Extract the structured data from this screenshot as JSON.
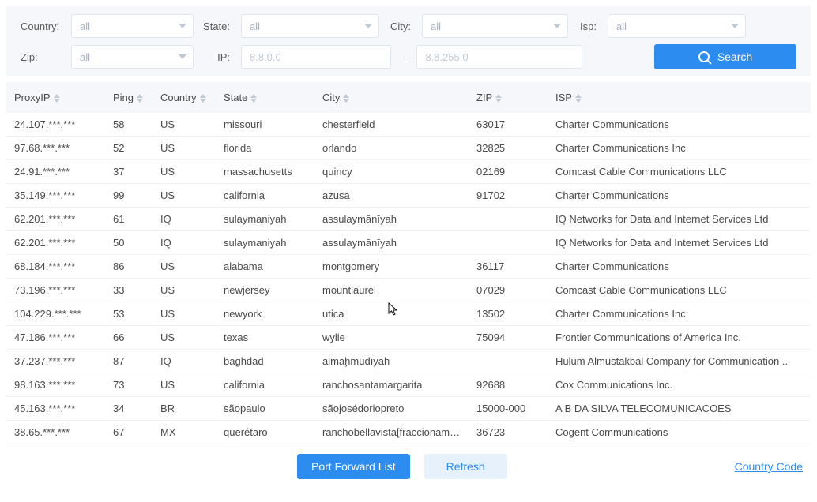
{
  "filters": {
    "country": {
      "label": "Country:",
      "value": "all"
    },
    "state": {
      "label": "State:",
      "value": "all"
    },
    "city": {
      "label": "City:",
      "value": "all"
    },
    "isp": {
      "label": "Isp:",
      "value": "all"
    },
    "zip": {
      "label": "Zip:",
      "value": "all"
    },
    "ip": {
      "label": "IP:",
      "from_placeholder": "8.8.0.0",
      "to_placeholder": "8.8.255.0",
      "dash": "-"
    }
  },
  "search_button": "Search",
  "columns": {
    "proxyip": "ProxyIP",
    "ping": "Ping",
    "country": "Country",
    "state": "State",
    "city": "City",
    "zip": "ZIP",
    "isp": "ISP"
  },
  "rows": [
    {
      "proxy": "24.107.***.***",
      "ping": "58",
      "country": "US",
      "state": "missouri",
      "city": "chesterfield",
      "zip": "63017",
      "isp": "Charter Communications"
    },
    {
      "proxy": "97.68.***.***",
      "ping": "52",
      "country": "US",
      "state": "florida",
      "city": "orlando",
      "zip": "32825",
      "isp": "Charter Communications Inc"
    },
    {
      "proxy": "24.91.***.***",
      "ping": "37",
      "country": "US",
      "state": "massachusetts",
      "city": "quincy",
      "zip": "02169",
      "isp": "Comcast Cable Communications LLC"
    },
    {
      "proxy": "35.149.***.***",
      "ping": "99",
      "country": "US",
      "state": "california",
      "city": "azusa",
      "zip": "91702",
      "isp": "Charter Communications"
    },
    {
      "proxy": "62.201.***.***",
      "ping": "61",
      "country": "IQ",
      "state": "sulaymaniyah",
      "city": "assulaymānīyah",
      "zip": "",
      "isp": "IQ Networks for Data and Internet Services Ltd"
    },
    {
      "proxy": "62.201.***.***",
      "ping": "50",
      "country": "IQ",
      "state": "sulaymaniyah",
      "city": "assulaymānīyah",
      "zip": "",
      "isp": "IQ Networks for Data and Internet Services Ltd"
    },
    {
      "proxy": "68.184.***.***",
      "ping": "86",
      "country": "US",
      "state": "alabama",
      "city": "montgomery",
      "zip": "36117",
      "isp": "Charter Communications"
    },
    {
      "proxy": "73.196.***.***",
      "ping": "33",
      "country": "US",
      "state": "newjersey",
      "city": "mountlaurel",
      "zip": "07029",
      "isp": "Comcast Cable Communications LLC"
    },
    {
      "proxy": "104.229.***.***",
      "ping": "53",
      "country": "US",
      "state": "newyork",
      "city": "utica",
      "zip": "13502",
      "isp": "Charter Communications Inc"
    },
    {
      "proxy": "47.186.***.***",
      "ping": "66",
      "country": "US",
      "state": "texas",
      "city": "wylie",
      "zip": "75094",
      "isp": "Frontier Communications of America Inc."
    },
    {
      "proxy": "37.237.***.***",
      "ping": "87",
      "country": "IQ",
      "state": "baghdad",
      "city": "almaḩmūdīyah",
      "zip": "",
      "isp": "Hulum Almustakbal Company for Communication .."
    },
    {
      "proxy": "98.163.***.***",
      "ping": "73",
      "country": "US",
      "state": "california",
      "city": "ranchosantamargarita",
      "zip": "92688",
      "isp": "Cox Communications Inc."
    },
    {
      "proxy": "45.163.***.***",
      "ping": "34",
      "country": "BR",
      "state": "sãopaulo",
      "city": "sãojosédoriopreto",
      "zip": "15000-000",
      "isp": "A B DA SILVA TELECOMUNICACOES"
    },
    {
      "proxy": "38.65.***.***",
      "ping": "67",
      "country": "MX",
      "state": "querétaro",
      "city": "ranchobellavista[fraccionamie..",
      "zip": "36723",
      "isp": "Cogent Communications"
    }
  ],
  "buttons": {
    "port_forward": "Port Forward List",
    "refresh": "Refresh"
  },
  "country_code_link": "Country Code"
}
